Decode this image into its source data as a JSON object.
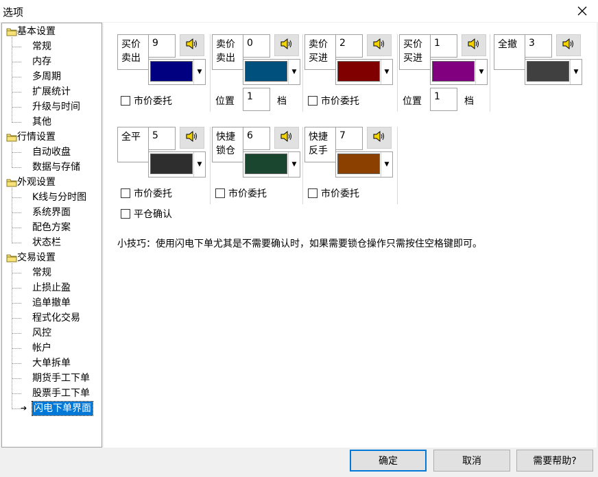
{
  "window": {
    "title": "选项"
  },
  "tree": {
    "categories": [
      {
        "label": "基本设置",
        "children": [
          "常规",
          "内存",
          "多周期",
          "扩展统计",
          "升级与时间",
          "其他"
        ]
      },
      {
        "label": "行情设置",
        "children": [
          "自动收盘",
          "数据与存储"
        ]
      },
      {
        "label": "外观设置",
        "children": [
          "K线与分时图",
          "系统界面",
          "配色方案",
          "状态栏"
        ]
      },
      {
        "label": "交易设置",
        "children": [
          "常规",
          "止损止盈",
          "追单撤单",
          "程式化交易",
          "风控",
          "帐户",
          "大单拆单",
          "期货手工下单",
          "股票手工下单",
          "闪电下单界面"
        ]
      }
    ],
    "selected": "闪电下单界面"
  },
  "groups": [
    {
      "label": "买价卖出",
      "key": "9",
      "color": "#000080",
      "checkbox": "市价委托"
    },
    {
      "label": "卖价卖出",
      "key": "0",
      "color": "#00507e",
      "position_label": "位置",
      "position_value": "1",
      "position_unit": "档"
    },
    {
      "label": "卖价买进",
      "key": "2",
      "color": "#800000",
      "checkbox": "市价委托"
    },
    {
      "label": "买价买进",
      "key": "1",
      "color": "#800080",
      "position_label": "位置",
      "position_value": "1",
      "position_unit": "档"
    },
    {
      "label": "全撤",
      "key": "3",
      "color": "#404040"
    },
    {
      "label": "全平",
      "key": "5",
      "color": "#2e2e2e",
      "checkbox": "市价委托",
      "checkbox2": "平仓确认"
    },
    {
      "label": "快捷锁仓",
      "key": "6",
      "color": "#1a4630",
      "checkbox": "市价委托"
    },
    {
      "label": "快捷反手",
      "key": "7",
      "color": "#8b4000",
      "checkbox": "市价委托"
    }
  ],
  "tip": "小技巧：使用闪电下单尤其是不需要确认时，如果需要锁仓操作只需按住空格键即可。",
  "buttons": {
    "ok": "确定",
    "cancel": "取消",
    "help": "需要帮助?"
  }
}
